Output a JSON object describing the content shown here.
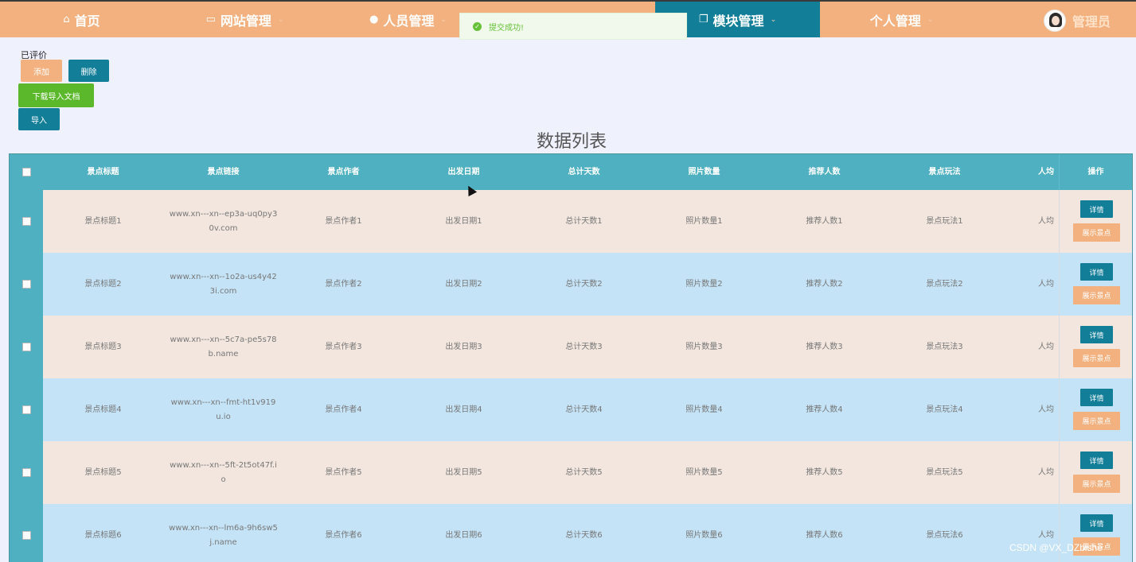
{
  "nav": {
    "items": [
      {
        "label": "首页",
        "icon": "home-icon",
        "glyph": "⌂",
        "caret": ""
      },
      {
        "label": "网站管理",
        "icon": "monitor-icon",
        "glyph": "▭",
        "caret": "⌄"
      },
      {
        "label": "人员管理",
        "icon": "user-icon",
        "glyph": "●",
        "caret": "⌄"
      },
      {
        "label": "模块管理",
        "icon": "copy-icon",
        "glyph": "❐",
        "caret": "⌄"
      },
      {
        "label": "个人管理",
        "icon": "",
        "glyph": "",
        "caret": "⌄"
      }
    ],
    "active": "模块管理",
    "user_name": "管理员"
  },
  "toast": {
    "message": "提交成功!",
    "icon": "success-check-icon"
  },
  "toolbar": {
    "crumb": "已评价",
    "add_label": "添加",
    "delete_label": "删除",
    "download_label": "下载导入文档",
    "import_label": "导入"
  },
  "list_title": "数据列表",
  "table": {
    "headers": [
      "景点标题",
      "景点链接",
      "景点作者",
      "出发日期",
      "总计天数",
      "照片数量",
      "推荐人数",
      "景点玩法",
      "人均"
    ],
    "op_header": "操作",
    "detail_label": "详情",
    "show_label": "展示景点",
    "rows": [
      [
        "景点标题1",
        "www.xn---xn--ep3a-uq0py30v.com",
        "景点作者1",
        "出发日期1",
        "总计天数1",
        "照片数量1",
        "推荐人数1",
        "景点玩法1",
        "人均"
      ],
      [
        "景点标题2",
        "www.xn---xn--1o2a-us4y423i.com",
        "景点作者2",
        "出发日期2",
        "总计天数2",
        "照片数量2",
        "推荐人数2",
        "景点玩法2",
        "人均"
      ],
      [
        "景点标题3",
        "www.xn---xn--5c7a-pe5s78b.name",
        "景点作者3",
        "出发日期3",
        "总计天数3",
        "照片数量3",
        "推荐人数3",
        "景点玩法3",
        "人均"
      ],
      [
        "景点标题4",
        "www.xn---xn--fmt-ht1v919u.io",
        "景点作者4",
        "出发日期4",
        "总计天数4",
        "照片数量4",
        "推荐人数4",
        "景点玩法4",
        "人均"
      ],
      [
        "景点标题5",
        "www.xn---xn--5ft-2t5ot47f.io",
        "景点作者5",
        "出发日期5",
        "总计天数5",
        "照片数量5",
        "推荐人数5",
        "景点玩法5",
        "人均"
      ],
      [
        "景点标题6",
        "www.xn---xn--lm6a-9h6sw5j.name",
        "景点作者6",
        "出发日期6",
        "总计天数6",
        "照片数量6",
        "推荐人数6",
        "景点玩法6",
        "人均"
      ]
    ]
  },
  "watermark": "CSDN @VX_DZbishe",
  "colors": {
    "nav_bg": "#f3b17f",
    "nav_active": "#127e98",
    "table_head": "#4eb0c0",
    "row_odd": "#f2e6de",
    "row_even": "#c4e3f6",
    "btn_green": "#5bb82a"
  }
}
